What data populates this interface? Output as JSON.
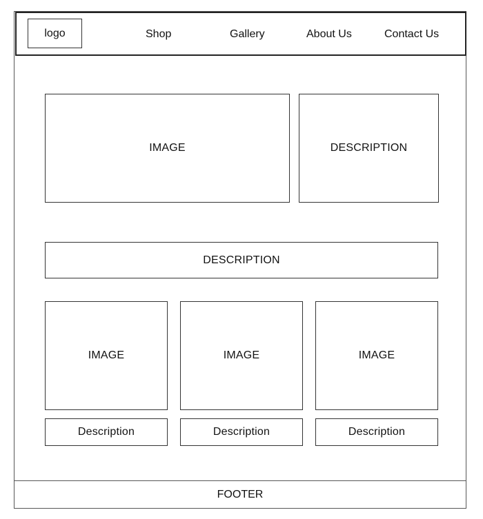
{
  "header": {
    "logo": "logo",
    "nav": {
      "shop": "Shop",
      "gallery": "Gallery",
      "about": "About Us",
      "contact": "Contact Us"
    }
  },
  "main": {
    "hero": {
      "image": "IMAGE",
      "description": "DESCRIPTION"
    },
    "banner": "DESCRIPTION",
    "cards": [
      {
        "image": "IMAGE",
        "description": "Description"
      },
      {
        "image": "IMAGE",
        "description": "Description"
      },
      {
        "image": "IMAGE",
        "description": "Description"
      }
    ]
  },
  "footer": {
    "text": "FOOTER"
  }
}
